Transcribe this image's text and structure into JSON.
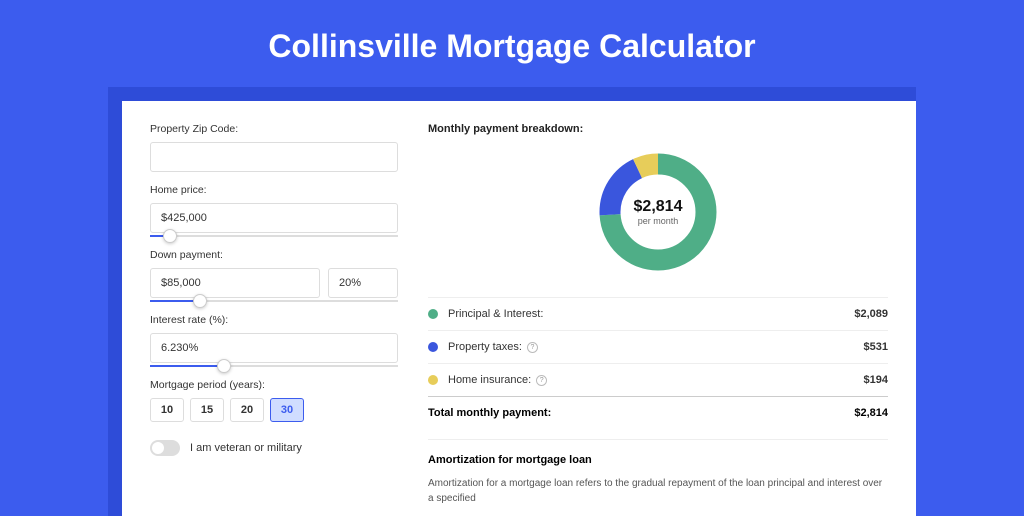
{
  "title": "Collinsville Mortgage Calculator",
  "form": {
    "zip_label": "Property Zip Code:",
    "zip_value": "",
    "home_price_label": "Home price:",
    "home_price_value": "$425,000",
    "home_price_slider_pct": 8,
    "down_payment_label": "Down payment:",
    "down_payment_value": "$85,000",
    "down_payment_pct": "20%",
    "down_payment_slider_pct": 20,
    "interest_label": "Interest rate (%):",
    "interest_value": "6.230%",
    "interest_slider_pct": 30,
    "period_label": "Mortgage period (years):",
    "periods": [
      "10",
      "15",
      "20",
      "30"
    ],
    "period_active_index": 3,
    "veteran_label": "I am veteran or military"
  },
  "breakdown": {
    "title": "Monthly payment breakdown:",
    "center_amount": "$2,814",
    "center_sub": "per month",
    "items": [
      {
        "label": "Principal & Interest:",
        "value": "$2,089",
        "info": false,
        "color": "green"
      },
      {
        "label": "Property taxes:",
        "value": "$531",
        "info": true,
        "color": "blue"
      },
      {
        "label": "Home insurance:",
        "value": "$194",
        "info": true,
        "color": "yellow"
      }
    ],
    "total_label": "Total monthly payment:",
    "total_value": "$2,814"
  },
  "chart_data": {
    "type": "pie",
    "title": "Monthly payment breakdown",
    "series": [
      {
        "name": "Principal & Interest",
        "value": 2089,
        "color": "#4fae87"
      },
      {
        "name": "Property taxes",
        "value": 531,
        "color": "#3a56dd"
      },
      {
        "name": "Home insurance",
        "value": 194,
        "color": "#e7cd5a"
      }
    ],
    "total": 2814,
    "unit": "$ per month"
  },
  "amortization": {
    "title": "Amortization for mortgage loan",
    "text": "Amortization for a mortgage loan refers to the gradual repayment of the loan principal and interest over a specified"
  }
}
